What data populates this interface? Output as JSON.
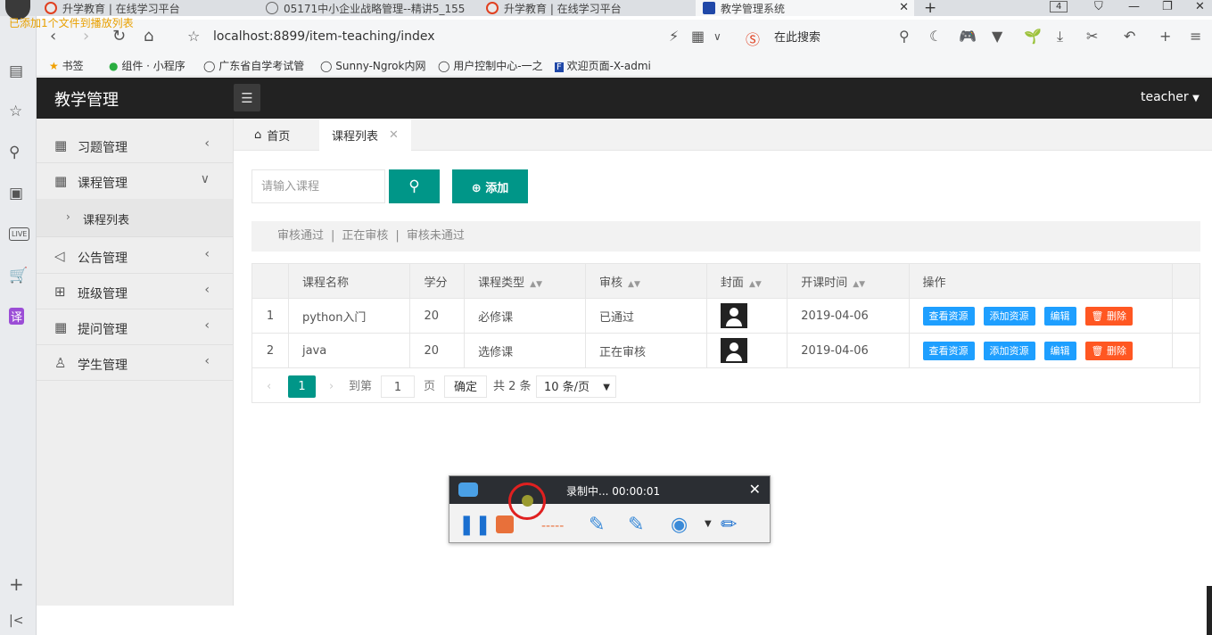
{
  "browser": {
    "tabs": [
      {
        "title": "升学教育 | 在线学习平台"
      },
      {
        "title": "05171中小企业战略管理--精讲5_155"
      },
      {
        "title": "升学教育 | 在线学习平台"
      },
      {
        "title": "教学管理系统"
      }
    ],
    "tab_count": "4",
    "notice": "已添加1个文件到播放列表",
    "url": "localhost:8899/item-teaching/index",
    "search_placeholder": "在此搜索",
    "bookmarks": [
      {
        "label": "书签"
      },
      {
        "label": "组件 · 小程序"
      },
      {
        "label": "广东省自学考试管"
      },
      {
        "label": "Sunny-Ngrok内网"
      },
      {
        "label": "用户控制中心-一之"
      },
      {
        "label": "欢迎页面-X-admi"
      }
    ],
    "sidebar_live": "LIVE",
    "sidebar_translate": "译"
  },
  "app": {
    "title": "教学管理",
    "user": "teacher",
    "menu": [
      {
        "label": "习题管理",
        "icon": "calendar-icon"
      },
      {
        "label": "课程管理",
        "icon": "calendar-icon",
        "expanded": true
      },
      {
        "label": "公告管理",
        "icon": "speaker-icon"
      },
      {
        "label": "班级管理",
        "icon": "grid-icon"
      },
      {
        "label": "提问管理",
        "icon": "calendar-icon"
      },
      {
        "label": "学生管理",
        "icon": "user-icon"
      }
    ],
    "submenu": {
      "label": "课程列表"
    },
    "page_tabs": [
      {
        "label": "首页"
      },
      {
        "label": "课程列表"
      }
    ]
  },
  "content": {
    "search_placeholder": "请输入课程",
    "add_label": "添加",
    "filters": [
      "审核通过",
      "正在审核",
      "审核未通过"
    ],
    "columns": [
      "课程名称",
      "学分",
      "课程类型",
      "审核",
      "封面",
      "开课时间",
      "操作"
    ],
    "rows": [
      {
        "index": "1",
        "name": "python入门",
        "credit": "20",
        "type": "必修课",
        "status": "已通过",
        "date": "2019-04-06"
      },
      {
        "index": "2",
        "name": "java",
        "credit": "20",
        "type": "选修课",
        "status": "正在审核",
        "date": "2019-04-06"
      }
    ],
    "actions": {
      "view": "查看资源",
      "add": "添加资源",
      "edit": "编辑",
      "delete": "删除"
    },
    "pager": {
      "current": "1",
      "goto_label": "到第",
      "goto_value": "1",
      "page_unit": "页",
      "confirm": "确定",
      "total": "共 2 条",
      "page_size": "10 条/页"
    }
  },
  "recorder": {
    "status": "录制中... 00:00:01"
  },
  "colors": {
    "primary": "#009688",
    "header": "#222222",
    "action_blue": "#1e9fff",
    "action_red": "#ff5722"
  }
}
